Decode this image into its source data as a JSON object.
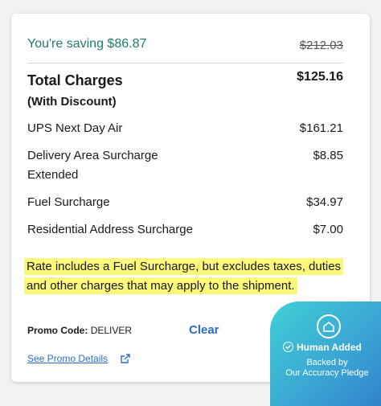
{
  "summary": {
    "saving": "You're saving $86.87",
    "original_price": "$212.03",
    "total_title": "Total Charges",
    "total_subtitle": "(With Discount)",
    "total_amount": "$125.16"
  },
  "charges": [
    {
      "label": "UPS Next Day Air",
      "amount": "$161.21"
    },
    {
      "label": "Delivery Area Surcharge\nExtended",
      "label_line1": "Delivery Area Surcharge",
      "label_line2": "Extended",
      "amount": "$8.85"
    },
    {
      "label": "Fuel Surcharge",
      "amount": "$34.97"
    },
    {
      "label": "Residential Address Surcharge",
      "amount": "$7.00"
    }
  ],
  "note": "Rate includes a Fuel Surcharge, but excludes taxes, duties and other charges that may apply to the shipment.",
  "promo": {
    "label": "Promo Code:",
    "code": "DELIVER",
    "clear_label": "Clear",
    "details_link": "See Promo Details"
  },
  "badge": {
    "title": "Human Added",
    "line1": "Backed by",
    "line2": "Our Accuracy Pledge"
  },
  "colors": {
    "saving": "#1f7a6d",
    "link": "#2b6cc4",
    "highlight": "#fbf77a",
    "badge": "#3aa2d3"
  }
}
